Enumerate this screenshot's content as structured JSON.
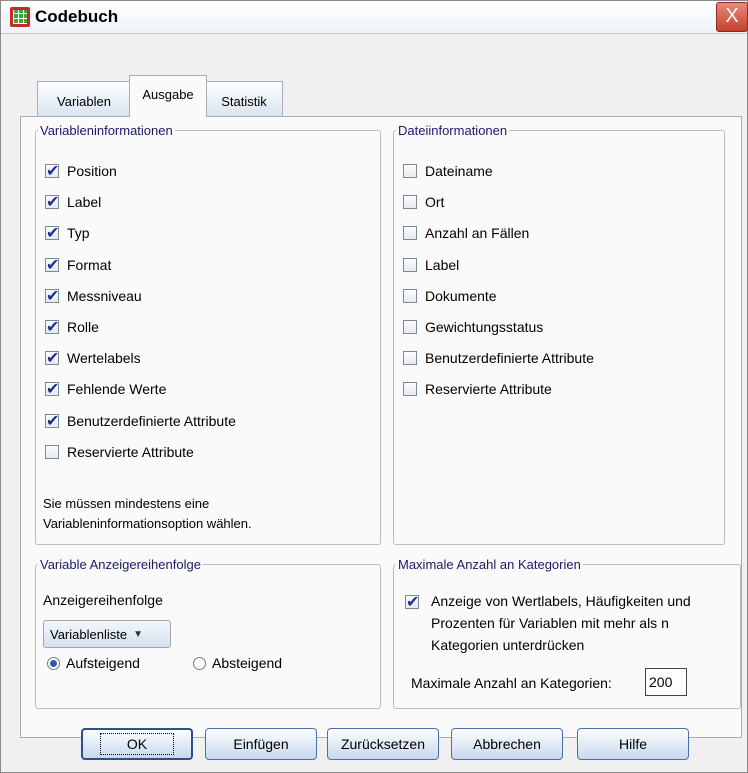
{
  "window": {
    "title": "Codebuch",
    "close_label": "X"
  },
  "tabs": [
    {
      "label": "Variablen",
      "active": false
    },
    {
      "label": "Ausgabe",
      "active": true
    },
    {
      "label": "Statistik",
      "active": false
    }
  ],
  "var_info": {
    "legend": "Variableninformationen",
    "items": [
      {
        "label": "Position",
        "checked": true
      },
      {
        "label": "Label",
        "checked": true
      },
      {
        "label": "Typ",
        "checked": true
      },
      {
        "label": "Format",
        "checked": true
      },
      {
        "label": "Messniveau",
        "checked": true
      },
      {
        "label": "Rolle",
        "checked": true
      },
      {
        "label": "Wertelabels",
        "checked": true
      },
      {
        "label": "Fehlende Werte",
        "checked": true
      },
      {
        "label": "Benutzerdefinierte Attribute",
        "checked": true
      },
      {
        "label": "Reservierte Attribute",
        "checked": false
      }
    ],
    "note_line1": "Sie müssen mindestens eine",
    "note_line2": "Variableninformationsoption wählen."
  },
  "file_info": {
    "legend": "Dateiinformationen",
    "items": [
      {
        "label": "Dateiname",
        "checked": false
      },
      {
        "label": "Ort",
        "checked": false
      },
      {
        "label": "Anzahl an Fällen",
        "checked": false
      },
      {
        "label": "Label",
        "checked": false
      },
      {
        "label": "Dokumente",
        "checked": false
      },
      {
        "label": "Gewichtungsstatus",
        "checked": false
      },
      {
        "label": "Benutzerdefinierte Attribute",
        "checked": false
      },
      {
        "label": "Reservierte Attribute",
        "checked": false
      }
    ]
  },
  "display_order": {
    "legend": "Variable Anzeigereihenfolge",
    "label": "Anzeigereihenfolge",
    "dropdown_value": "Variablenliste",
    "radio_ascending": "Aufsteigend",
    "radio_descending": "Absteigend",
    "selected": "ascending"
  },
  "max_categories": {
    "legend": "Maximale Anzahl an Kategorien",
    "suppress_checked": true,
    "suppress_line1": "Anzeige von Wertlabels, Häufigkeiten und",
    "suppress_line2": "Prozenten für Variablen mit mehr als n",
    "suppress_line3": "Kategorien unterdrücken",
    "max_label": "Maximale Anzahl an Kategorien:",
    "max_value": "200"
  },
  "buttons": {
    "ok": "OK",
    "paste": "Einfügen",
    "reset": "Zurücksetzen",
    "cancel": "Abbrechen",
    "help": "Hilfe"
  }
}
